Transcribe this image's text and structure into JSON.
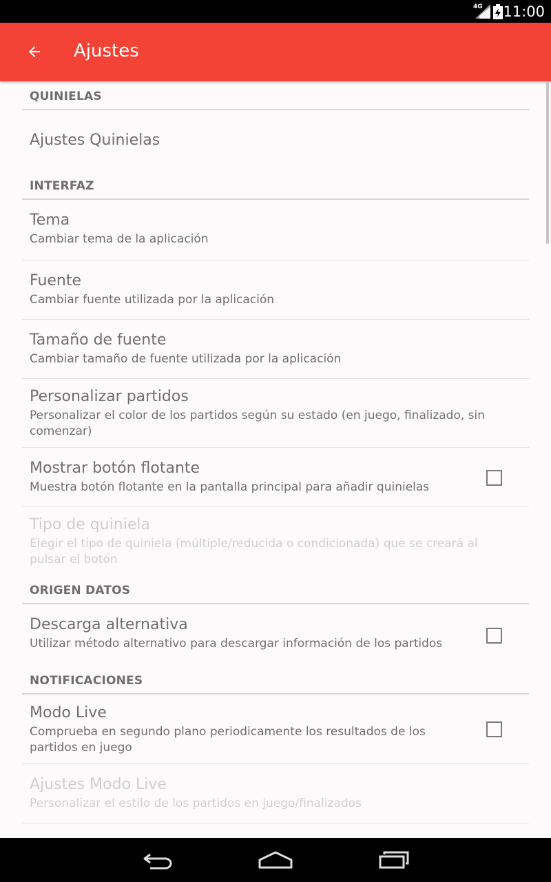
{
  "status_bar": {
    "network": "4G",
    "time": "11:00"
  },
  "app_bar": {
    "title": "Ajustes",
    "accent_color": "#f44336"
  },
  "sections": [
    {
      "header": "QUINIELAS",
      "items": [
        {
          "title": "Ajustes Quinielas",
          "summary": "",
          "checkbox": false,
          "enabled": true
        }
      ]
    },
    {
      "header": "INTERFAZ",
      "items": [
        {
          "title": "Tema",
          "summary": "Cambiar tema de la aplicación",
          "checkbox": false,
          "enabled": true
        },
        {
          "title": "Fuente",
          "summary": "Cambiar fuente utilizada por la aplicación",
          "checkbox": false,
          "enabled": true
        },
        {
          "title": "Tamaño de fuente",
          "summary": "Cambiar tamaño de fuente utilizada por la aplicación",
          "checkbox": false,
          "enabled": true
        },
        {
          "title": "Personalizar partidos",
          "summary": "Personalizar el color de los partidos según su estado (en juego, finalizado, sin comenzar)",
          "checkbox": false,
          "enabled": true
        },
        {
          "title": "Mostrar botón flotante",
          "summary": "Muestra botón flotante en la pantalla principal para añadir quinielas",
          "checkbox": true,
          "checked": false,
          "enabled": true
        },
        {
          "title": "Tipo de quiniela",
          "summary": "Elegir el tipo de quiniela (múltiple/reducida o condicionada) que se creará al pulsar el botón",
          "checkbox": false,
          "enabled": false
        }
      ]
    },
    {
      "header": "ORIGEN DATOS",
      "items": [
        {
          "title": "Descarga alternativa",
          "summary": "Utilizar método alternativo para descargar información de los partidos",
          "checkbox": true,
          "checked": false,
          "enabled": true
        }
      ]
    },
    {
      "header": "NOTIFICACIONES",
      "items": [
        {
          "title": "Modo Live",
          "summary": "Comprueba en segundo plano periodicamente los resultados de los partidos en juego",
          "checkbox": true,
          "checked": false,
          "enabled": true
        },
        {
          "title": "Ajustes Modo Live",
          "summary": "Personalizar el estilo de los partidos en juego/finalizados",
          "checkbox": false,
          "enabled": false
        }
      ]
    }
  ],
  "nav_bar": {
    "icons": [
      "back-icon",
      "home-icon",
      "recents-icon"
    ]
  }
}
